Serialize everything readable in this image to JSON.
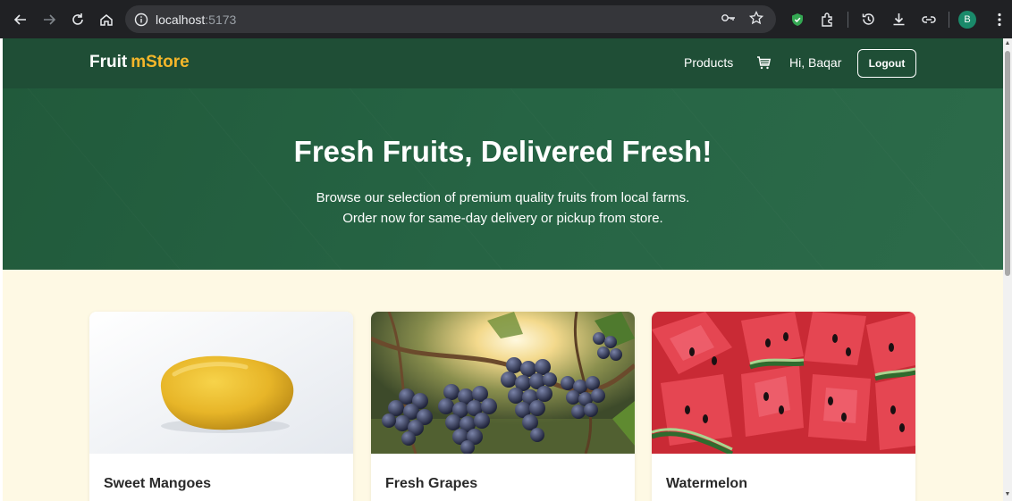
{
  "browser": {
    "url_host": "localhost",
    "url_port": ":5173",
    "profile_initial": "B"
  },
  "site": {
    "logo_main": "Fruit",
    "logo_accent": "mStore",
    "nav_products": "Products",
    "greeting": "Hi, Baqar",
    "logout_label": "Logout"
  },
  "hero": {
    "title": "Fresh Fruits, Delivered Fresh!",
    "subtitle_line1": "Browse our selection of premium quality fruits from local farms.",
    "subtitle_line2": "Order now for same-day delivery or pickup from store."
  },
  "products": [
    {
      "name": "Sweet Mangoes"
    },
    {
      "name": "Fresh Grapes"
    },
    {
      "name": "Watermelon"
    }
  ],
  "colors": {
    "header_bg": "#1f4e36",
    "hero_bg": "#266444",
    "logo_accent": "#f5b72a",
    "page_bg": "#fef9e4"
  }
}
